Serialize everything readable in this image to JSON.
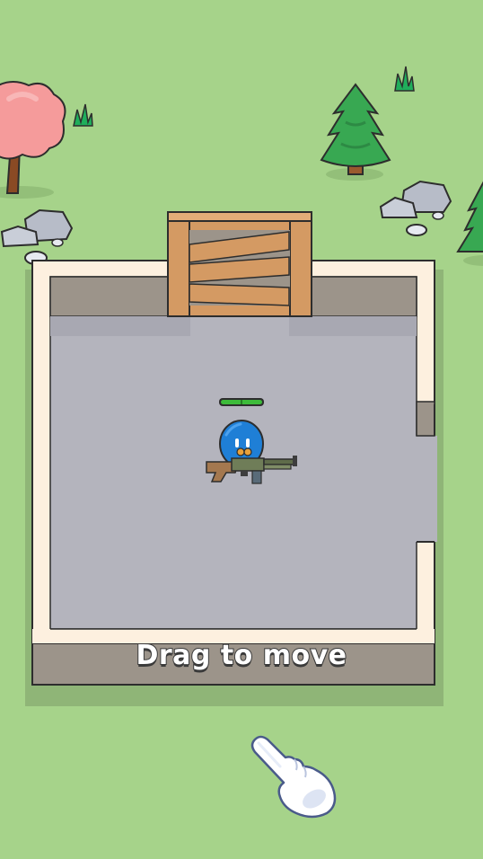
{
  "tutorial": {
    "instruction": "Drag to move"
  },
  "player": {
    "health_fraction": 1.0,
    "weapon": "shotgun"
  },
  "colors": {
    "grass": "#a6d38a",
    "floor": "#b4b4bd",
    "wall_cream": "#fdf0df",
    "wall_stone": "#9c948a",
    "door_wood": "#d49a63",
    "player_blue": "#1f7fd6",
    "health_green": "#3dbb3a"
  },
  "icons": {
    "hand": "pointing-hand-icon",
    "tree_pink": "pink-tree-icon",
    "tree_pine": "pine-tree-icon",
    "rock": "rock-icon",
    "grass_tuft": "grass-tuft-icon"
  }
}
